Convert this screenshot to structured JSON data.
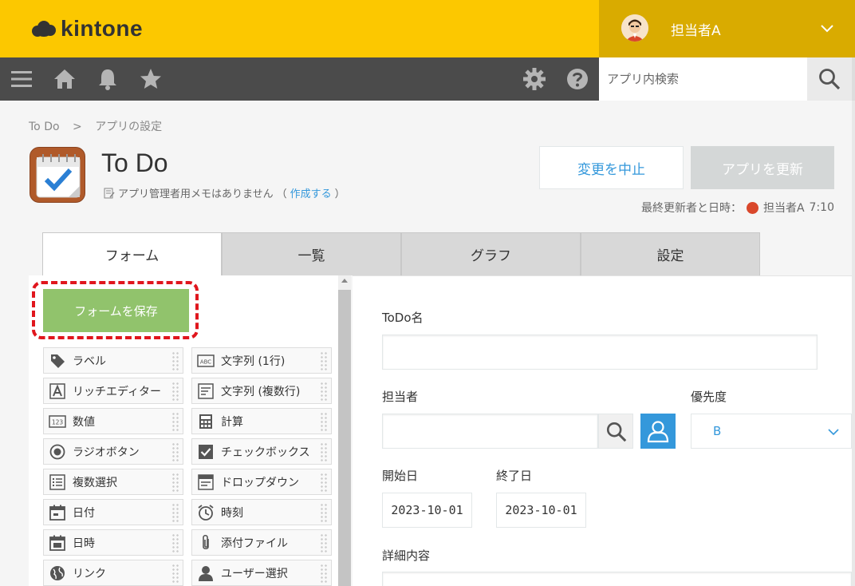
{
  "header": {
    "logo_text": "kintone",
    "user_name": "担当者A"
  },
  "toolbar": {
    "icons": [
      "menu-icon",
      "home-icon",
      "bell-icon",
      "star-icon",
      "gear-icon",
      "help-icon"
    ],
    "search_placeholder": "アプリ内検索"
  },
  "breadcrumb": [
    "To Do",
    ">",
    "アプリの設定"
  ],
  "app": {
    "title": "To Do",
    "memo_text": "アプリ管理者用メモはありません",
    "memo_paren_open": "（",
    "memo_link": "作成する",
    "memo_paren_close": "）"
  },
  "actions": {
    "cancel_label": "変更を中止",
    "update_label": "アプリを更新",
    "updated_label": "最終更新者と日時：",
    "updated_user": "担当者A",
    "updated_time": "7:10"
  },
  "tabs": [
    {
      "label": "フォーム",
      "active": true
    },
    {
      "label": "一覧",
      "active": false
    },
    {
      "label": "グラフ",
      "active": false
    },
    {
      "label": "設定",
      "active": false
    }
  ],
  "palette": {
    "save_label": "フォームを保存",
    "items": [
      {
        "label": "ラベル",
        "icon": "tag-icon"
      },
      {
        "label": "文字列 (1行)",
        "icon": "abc-icon"
      },
      {
        "label": "リッチエディター",
        "icon": "rich-text-icon"
      },
      {
        "label": "文字列 (複数行)",
        "icon": "multiline-icon"
      },
      {
        "label": "数値",
        "icon": "number-icon"
      },
      {
        "label": "計算",
        "icon": "calculator-icon"
      },
      {
        "label": "ラジオボタン",
        "icon": "radio-icon"
      },
      {
        "label": "チェックボックス",
        "icon": "checkbox-icon"
      },
      {
        "label": "複数選択",
        "icon": "multi-select-icon"
      },
      {
        "label": "ドロップダウン",
        "icon": "dropdown-icon"
      },
      {
        "label": "日付",
        "icon": "calendar-icon"
      },
      {
        "label": "時刻",
        "icon": "clock-icon"
      },
      {
        "label": "日時",
        "icon": "datetime-icon"
      },
      {
        "label": "添付ファイル",
        "icon": "paperclip-icon"
      },
      {
        "label": "リンク",
        "icon": "globe-icon"
      },
      {
        "label": "ユーザー選択",
        "icon": "user-icon"
      }
    ]
  },
  "form": {
    "todo_label": "ToDo名",
    "assignee_label": "担当者",
    "priority_label": "優先度",
    "priority_value": "B",
    "start_label": "開始日",
    "start_value": "2023-10-01",
    "end_label": "終了日",
    "end_value": "2023-10-01",
    "detail_label": "詳細内容"
  },
  "colors": {
    "header_yellow": "#fcc800",
    "user_area": "#d9ab00",
    "toolbar": "#4b4b4b",
    "accent_blue": "#3498db",
    "save_green": "#91c36c",
    "highlight_red": "#e0161d"
  }
}
